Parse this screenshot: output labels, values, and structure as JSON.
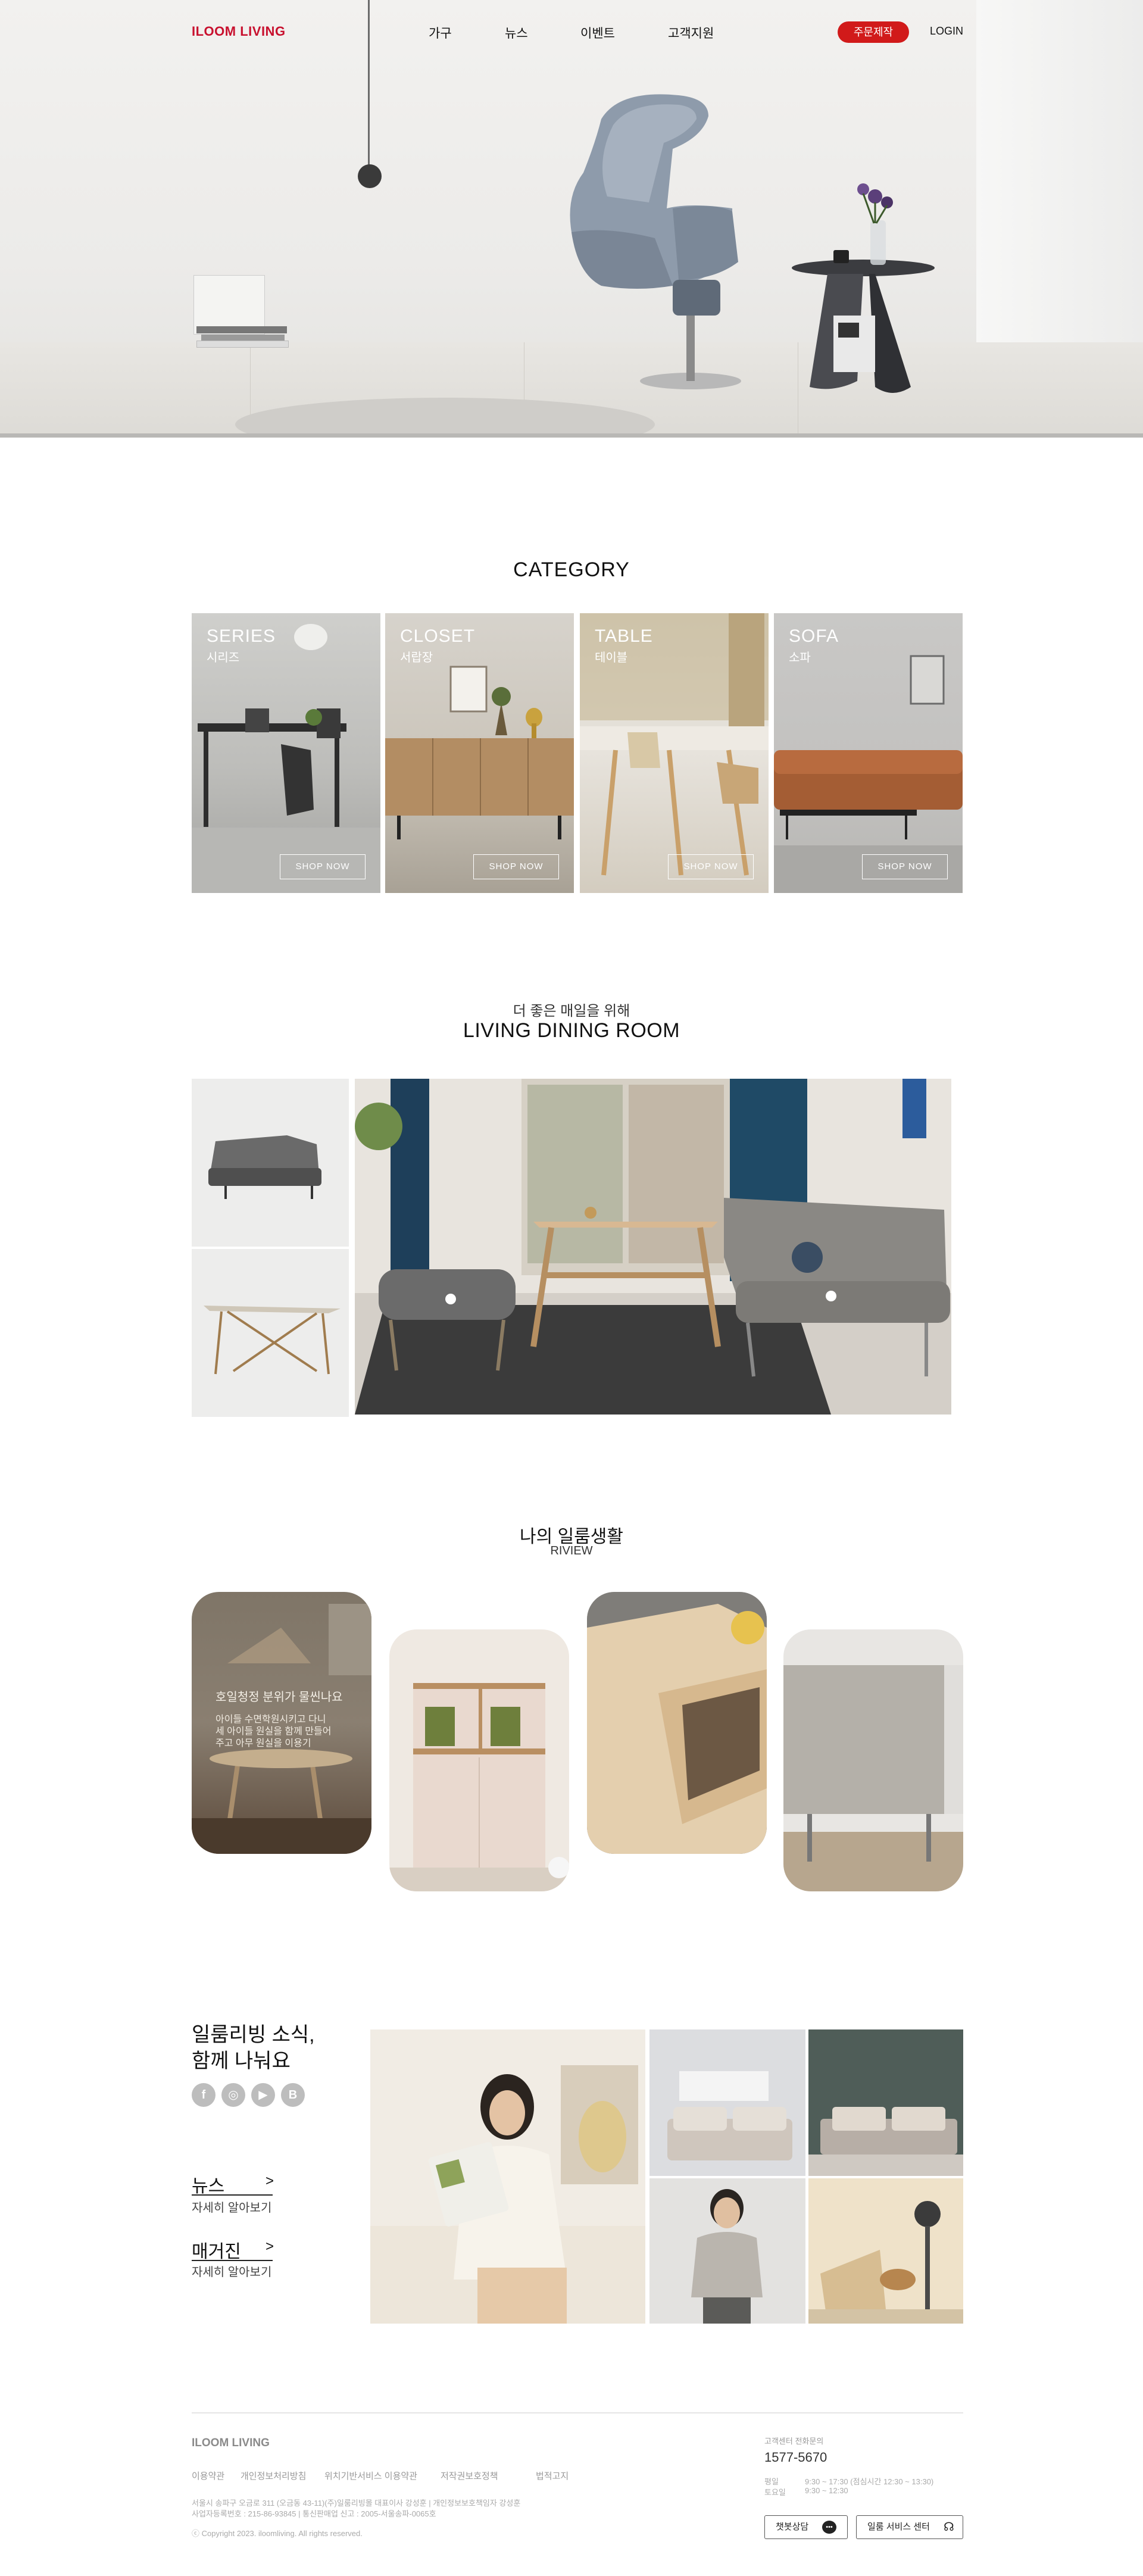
{
  "header": {
    "logo": "ILOOM LIVING",
    "nav": [
      "가구",
      "뉴스",
      "이벤트",
      "고객지원"
    ],
    "order_button": "주문제작",
    "login": "LOGIN"
  },
  "category": {
    "title": "CATEGORY",
    "items": [
      {
        "en": "SERIES",
        "ko": "시리즈",
        "button": "SHOP NOW"
      },
      {
        "en": "CLOSET",
        "ko": "서랍장",
        "button": "SHOP NOW"
      },
      {
        "en": "TABLE",
        "ko": "테이블",
        "button": "SHOP NOW"
      },
      {
        "en": "SOFA",
        "ko": "소파",
        "button": "SHOP NOW"
      }
    ]
  },
  "living": {
    "subtitle": "더 좋은 매일을 위해",
    "title": "LIVING DINING ROOM"
  },
  "review": {
    "title": "나의 일룸생활",
    "subtitle": "RIVIEW",
    "card1": {
      "heading": "호일청정 분위가 물씬나요",
      "lines": [
        "아이들 수면학원시키고 다니",
        "세 아이들 원실을 함께 만들어",
        "주고 아무 원실을 이용기"
      ]
    }
  },
  "news": {
    "title_line1": "일룸리빙 소식,",
    "title_line2": "함께 나눠요",
    "sns": [
      "f",
      "◎",
      "▶",
      "B"
    ],
    "links": [
      {
        "title": "뉴스",
        "sub": "자세히 알아보기",
        "arrow": ">"
      },
      {
        "title": "매거진",
        "sub": "자세히 알아보기",
        "arrow": ">"
      }
    ]
  },
  "footer": {
    "logo": "ILOOM LIVING",
    "links": [
      "이용약관",
      "개인정보처리방침",
      "위치기반서비스 이용약관",
      "저작권보호정책",
      "법적고지"
    ],
    "address1": "서울시 송파구 오금로 311 (오금동 43-11)(주)일룸리빙몰 대표이사 강성훈 | 개인정보보호책임자 강성훈",
    "address2": "사업자등록번호 : 215-86-93845 | 통신판매업 신고 : 2005-서울송파-0065호",
    "copyright": "ⓒ Copyright 2023. iloomliving. All rights reserved.",
    "cs_label": "고객센터 전화문의",
    "phone": "1577-5670",
    "hours_label1": "평일",
    "hours_value1": "9:30 ~ 17:30 (점심시간 12:30 ~ 13:30)",
    "hours_label2": "토요일",
    "hours_value2": "9:30 ~ 12:30",
    "chat_button": "챗봇상담",
    "service_button": "일룸 서비스 센터"
  },
  "colors": {
    "brand": "#c8102e",
    "order_button": "#d11a1a"
  }
}
